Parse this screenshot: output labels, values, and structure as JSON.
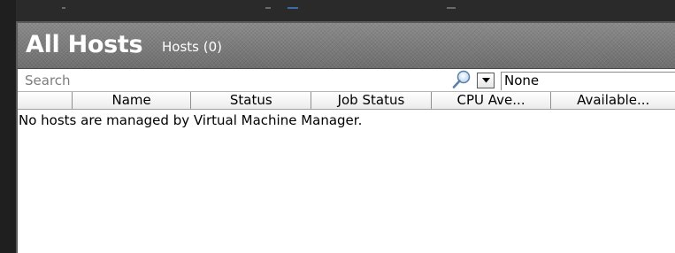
{
  "header": {
    "title": "All Hosts",
    "subtitle": "Hosts (0)"
  },
  "search": {
    "placeholder": "Search",
    "value": "",
    "filter_value": "None"
  },
  "grid": {
    "columns": [
      "",
      "Name",
      "Status",
      "Job Status",
      "CPU Ave...",
      "Available..."
    ],
    "empty_message": "No hosts are managed by Virtual Machine Manager."
  },
  "colors": {
    "header_bg": "#7a7a7a",
    "header_text": "#ffffff",
    "frame": "#2a2a2a"
  },
  "icons": {
    "search": "magnifier-icon",
    "dropdown": "chevron-down-icon"
  }
}
